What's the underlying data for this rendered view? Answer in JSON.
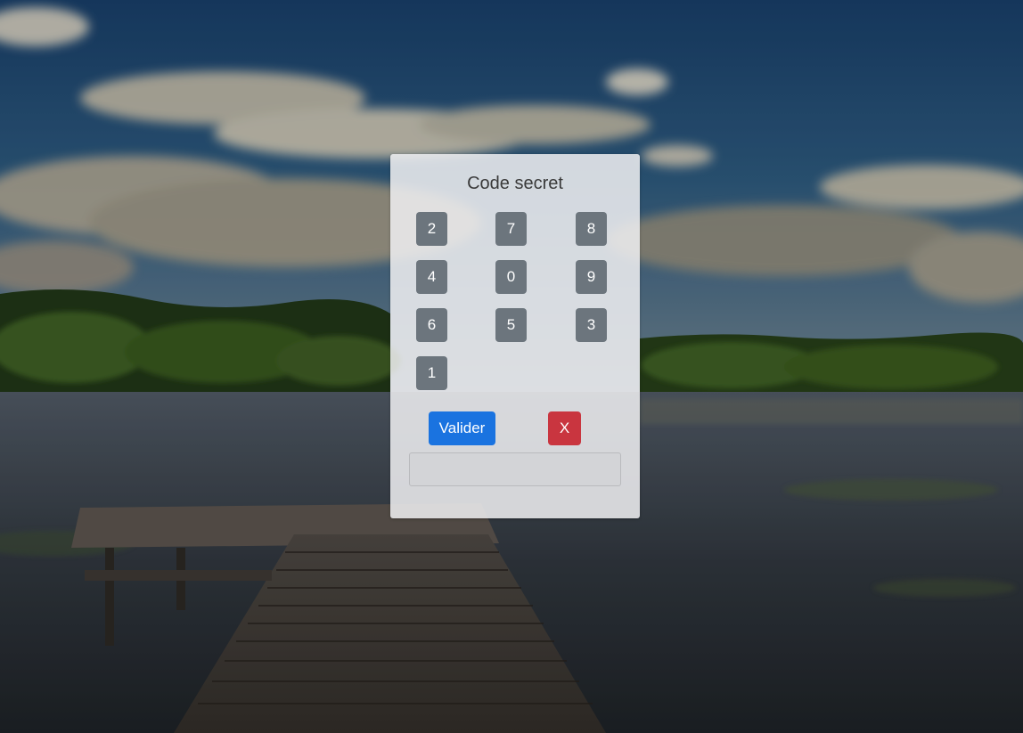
{
  "panel": {
    "title": "Code secret",
    "keys": [
      "2",
      "7",
      "8",
      "4",
      "0",
      "9",
      "6",
      "5",
      "3",
      "1"
    ],
    "validate_label": "Valider",
    "clear_label": "X",
    "code_value": ""
  },
  "colors": {
    "key_bg": "#6c757d",
    "validate_bg": "#1a73e0",
    "clear_bg": "#c9353f"
  }
}
